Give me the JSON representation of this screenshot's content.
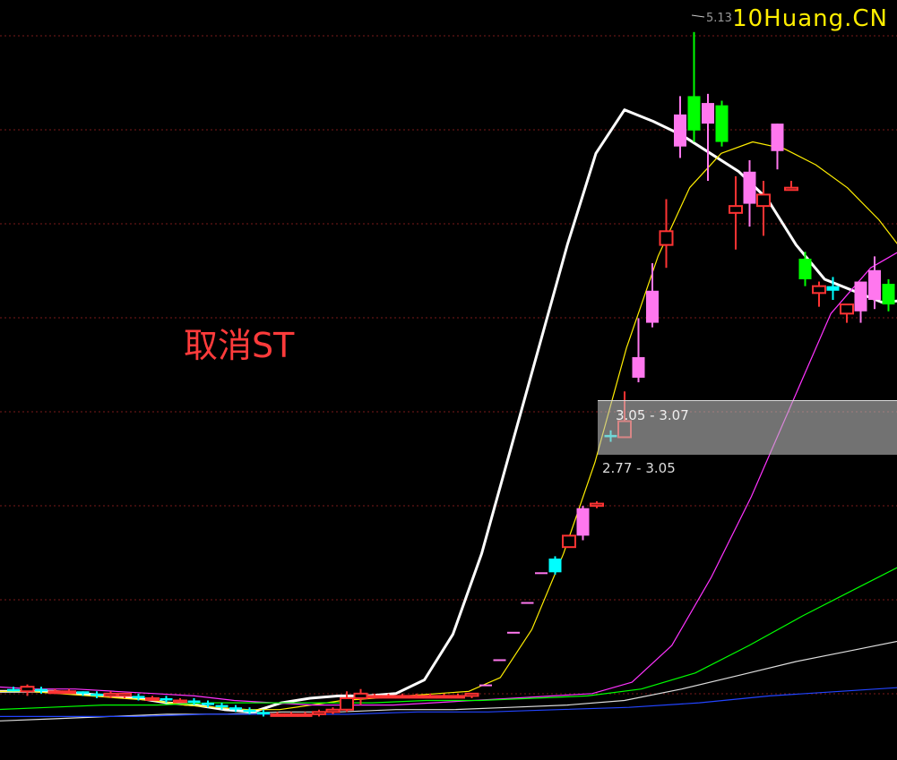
{
  "watermark": "10Huang.CN",
  "annotation": "取消ST",
  "price_ranges": [
    "3.05 - 3.07",
    "2.77 - 3.05"
  ],
  "chart_data": {
    "type": "candlestick",
    "title": "",
    "peak_label": "5.13",
    "ylim": [
      1.95,
      5.27
    ],
    "up_color": "#ff3333",
    "down_color": "#00ffff",
    "limit_up_color": "#ff77ee",
    "big_down_color": "#00ff00",
    "grid": true,
    "candles": [
      {
        "o": 2.26,
        "h": 2.27,
        "l": 2.25,
        "c": 2.25
      },
      {
        "o": 2.25,
        "h": 2.28,
        "l": 2.23,
        "c": 2.27
      },
      {
        "o": 2.26,
        "h": 2.27,
        "l": 2.24,
        "c": 2.25
      },
      {
        "o": 2.25,
        "h": 2.26,
        "l": 2.24,
        "c": 2.25
      },
      {
        "o": 2.25,
        "h": 2.26,
        "l": 2.24,
        "c": 2.25
      },
      {
        "o": 2.25,
        "h": 2.25,
        "l": 2.23,
        "c": 2.24
      },
      {
        "o": 2.24,
        "h": 2.25,
        "l": 2.22,
        "c": 2.23
      },
      {
        "o": 2.23,
        "h": 2.25,
        "l": 2.22,
        "c": 2.24
      },
      {
        "o": 2.23,
        "h": 2.24,
        "l": 2.22,
        "c": 2.24
      },
      {
        "o": 2.23,
        "h": 2.24,
        "l": 2.21,
        "c": 2.22
      },
      {
        "o": 2.22,
        "h": 2.23,
        "l": 2.21,
        "c": 2.22
      },
      {
        "o": 2.22,
        "h": 2.23,
        "l": 2.2,
        "c": 2.21
      },
      {
        "o": 2.21,
        "h": 2.22,
        "l": 2.2,
        "c": 2.21
      },
      {
        "o": 2.21,
        "h": 2.22,
        "l": 2.19,
        "c": 2.2
      },
      {
        "o": 2.2,
        "h": 2.21,
        "l": 2.18,
        "c": 2.19
      },
      {
        "o": 2.19,
        "h": 2.2,
        "l": 2.17,
        "c": 2.18
      },
      {
        "o": 2.18,
        "h": 2.19,
        "l": 2.16,
        "c": 2.17
      },
      {
        "o": 2.17,
        "h": 2.18,
        "l": 2.15,
        "c": 2.16
      },
      {
        "o": 2.16,
        "h": 2.17,
        "l": 2.14,
        "c": 2.15
      },
      {
        "o": 2.15,
        "h": 2.16,
        "l": 2.14,
        "c": 2.15
      },
      {
        "o": 2.15,
        "h": 2.16,
        "l": 2.14,
        "c": 2.15
      },
      {
        "o": 2.15,
        "h": 2.16,
        "l": 2.14,
        "c": 2.15
      },
      {
        "o": 2.15,
        "h": 2.17,
        "l": 2.14,
        "c": 2.16
      },
      {
        "o": 2.16,
        "h": 2.18,
        "l": 2.15,
        "c": 2.17
      },
      {
        "o": 2.17,
        "h": 2.25,
        "l": 2.16,
        "c": 2.22
      },
      {
        "o": 2.22,
        "h": 2.26,
        "l": 2.19,
        "c": 2.24
      },
      {
        "o": 2.23,
        "h": 2.24,
        "l": 2.22,
        "c": 2.23
      },
      {
        "o": 2.23,
        "h": 2.24,
        "l": 2.22,
        "c": 2.23
      },
      {
        "o": 2.23,
        "h": 2.24,
        "l": 2.22,
        "c": 2.23
      },
      {
        "o": 2.23,
        "h": 2.24,
        "l": 2.22,
        "c": 2.23
      },
      {
        "o": 2.23,
        "h": 2.24,
        "l": 2.22,
        "c": 2.23
      },
      {
        "o": 2.23,
        "h": 2.24,
        "l": 2.22,
        "c": 2.23
      },
      {
        "o": 2.23,
        "h": 2.24,
        "l": 2.22,
        "c": 2.23
      },
      {
        "o": 2.23,
        "h": 2.24,
        "l": 2.22,
        "c": 2.24
      },
      {
        "o": 2.28,
        "h": 2.28,
        "l": 2.28,
        "c": 2.28
      },
      {
        "o": 2.39,
        "h": 2.39,
        "l": 2.39,
        "c": 2.39
      },
      {
        "o": 2.51,
        "h": 2.51,
        "l": 2.51,
        "c": 2.51
      },
      {
        "o": 2.64,
        "h": 2.64,
        "l": 2.64,
        "c": 2.64
      },
      {
        "o": 2.77,
        "h": 2.77,
        "l": 2.77,
        "c": 2.77
      },
      {
        "o": 2.83,
        "h": 2.84,
        "l": 2.76,
        "c": 2.77
      },
      {
        "o": 2.88,
        "h": 2.93,
        "l": 2.88,
        "c": 2.93
      },
      {
        "o": 2.93,
        "h": 3.06,
        "l": 2.91,
        "c": 3.05
      },
      {
        "o": 3.06,
        "h": 3.08,
        "l": 3.05,
        "c": 3.07
      },
      {
        "o": 3.37,
        "h": 3.39,
        "l": 3.34,
        "c": 3.36
      },
      {
        "o": 3.36,
        "h": 3.56,
        "l": 3.36,
        "c": 3.43
      },
      {
        "o": 3.62,
        "h": 3.88,
        "l": 3.6,
        "c": 3.71
      },
      {
        "o": 3.86,
        "h": 4.12,
        "l": 3.84,
        "c": 4.0
      },
      {
        "o": 4.2,
        "h": 4.4,
        "l": 4.1,
        "c": 4.26
      },
      {
        "o": 4.63,
        "h": 4.85,
        "l": 4.58,
        "c": 4.77
      },
      {
        "o": 4.85,
        "h": 5.13,
        "l": 4.65,
        "c": 4.7
      },
      {
        "o": 4.73,
        "h": 4.86,
        "l": 4.48,
        "c": 4.82
      },
      {
        "o": 4.81,
        "h": 4.83,
        "l": 4.63,
        "c": 4.65
      },
      {
        "o": 4.34,
        "h": 4.5,
        "l": 4.18,
        "c": 4.37
      },
      {
        "o": 4.38,
        "h": 4.57,
        "l": 4.28,
        "c": 4.52
      },
      {
        "o": 4.37,
        "h": 4.48,
        "l": 4.24,
        "c": 4.42
      },
      {
        "o": 4.61,
        "h": 4.73,
        "l": 4.53,
        "c": 4.73
      },
      {
        "o": 4.44,
        "h": 4.48,
        "l": 4.44,
        "c": 4.45
      },
      {
        "o": 4.14,
        "h": 4.17,
        "l": 4.02,
        "c": 4.05
      },
      {
        "o": 3.99,
        "h": 4.04,
        "l": 3.93,
        "c": 4.02
      },
      {
        "o": 4.02,
        "h": 4.06,
        "l": 3.96,
        "c": 4.0
      },
      {
        "o": 3.9,
        "h": 3.94,
        "l": 3.86,
        "c": 3.94
      },
      {
        "o": 3.91,
        "h": 4.04,
        "l": 3.86,
        "c": 4.04
      },
      {
        "o": 3.96,
        "h": 4.15,
        "l": 3.92,
        "c": 4.09
      },
      {
        "o": 4.03,
        "h": 4.05,
        "l": 3.91,
        "c": 3.94
      }
    ],
    "moving_averages": [
      {
        "color": "#ffffff",
        "values": [
          2.25,
          2.25,
          2.25,
          2.24,
          2.23,
          2.22,
          2.2,
          2.19,
          2.17,
          2.16,
          2.2,
          2.22,
          2.23,
          2.23,
          2.24,
          2.3,
          2.5,
          2.85,
          3.3,
          3.75,
          4.2,
          4.6,
          4.79,
          4.74,
          4.68,
          4.6,
          4.52,
          4.4,
          4.2,
          4.05,
          4.0,
          3.95,
          3.96
        ]
      },
      {
        "color": "#ffee00",
        "values": [
          2.25,
          2.25,
          2.24,
          2.23,
          2.22,
          2.21,
          2.19,
          2.18,
          2.17,
          2.17,
          2.19,
          2.21,
          2.22,
          2.23,
          2.24,
          2.25,
          2.31,
          2.52,
          2.85,
          3.25,
          3.75,
          4.15,
          4.45,
          4.6,
          4.65,
          4.62,
          4.55,
          4.45,
          4.31,
          4.13
        ]
      },
      {
        "color": "#ff33ff",
        "values": [
          2.27,
          2.26,
          2.26,
          2.25,
          2.24,
          2.23,
          2.21,
          2.2,
          2.19,
          2.19,
          2.19,
          2.2,
          2.21,
          2.22,
          2.23,
          2.24,
          2.29,
          2.45,
          2.75,
          3.1,
          3.5,
          3.9,
          4.1,
          4.2
        ]
      },
      {
        "color": "#00ff00",
        "values": [
          2.17,
          2.18,
          2.19,
          2.19,
          2.2,
          2.2,
          2.2,
          2.2,
          2.21,
          2.21,
          2.22,
          2.23,
          2.26,
          2.33,
          2.45,
          2.58,
          2.7,
          2.82
        ]
      },
      {
        "color": "#dddddd",
        "values": [
          2.12,
          2.13,
          2.14,
          2.15,
          2.15,
          2.16,
          2.16,
          2.17,
          2.17,
          2.18,
          2.19,
          2.21,
          2.26,
          2.32,
          2.38,
          2.43,
          2.48
        ]
      },
      {
        "color": "#2244ff",
        "values": [
          2.14,
          2.14,
          2.14,
          2.15,
          2.15,
          2.15,
          2.16,
          2.16,
          2.17,
          2.18,
          2.2,
          2.23,
          2.25,
          2.27
        ]
      }
    ]
  }
}
